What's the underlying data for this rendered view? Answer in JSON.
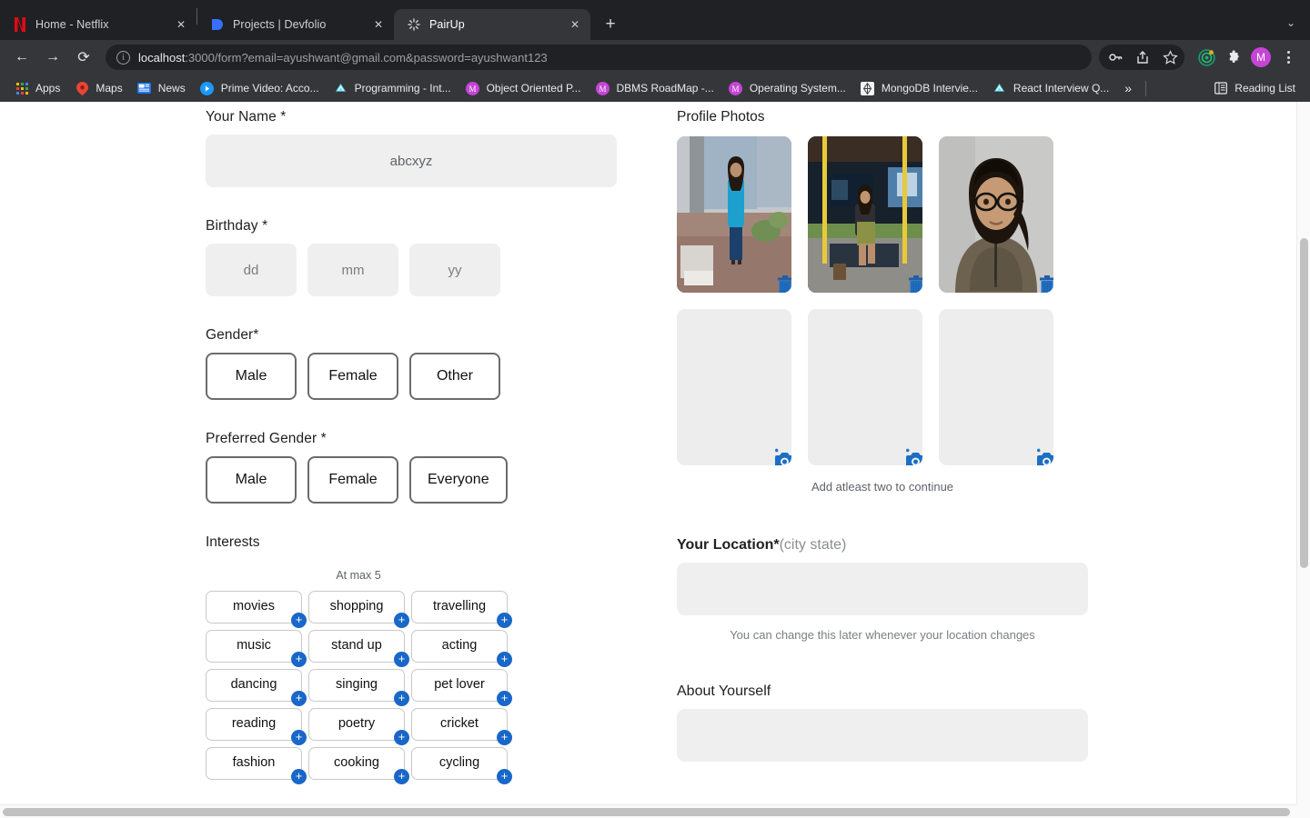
{
  "browser": {
    "tabs": [
      {
        "title": "Home - Netflix",
        "favicon": "netflix-icon",
        "active": false,
        "close_label": "✕"
      },
      {
        "title": "Projects | Devfolio",
        "favicon": "devfolio-icon",
        "active": false,
        "close_label": "✕"
      },
      {
        "title": "PairUp",
        "favicon": "loading-spinner-icon",
        "active": true,
        "close_label": "✕"
      }
    ],
    "new_tab_label": "+",
    "tabstrip_chevron": "⌄",
    "nav": {
      "back": "←",
      "forward": "→",
      "reload": "⟳"
    },
    "omnibox": {
      "info_icon_label": "i",
      "url_host": "localhost",
      "url_rest": ":3000/form?email=ayushwant@gmail.com&password=ayushwant123",
      "full_url": "localhost:3000/form?email=ayushwant@gmail.com&password=ayushwant123"
    },
    "toolbar_icons": [
      "password-key-icon",
      "share-icon",
      "bookmark-star-icon",
      "extension-target-icon",
      "extensions-puzzle-icon",
      "profile-avatar",
      "browser-menu-icon"
    ],
    "avatar_initial": "M",
    "bookmarks": [
      {
        "label": "Apps",
        "icon": "apps-grid-icon"
      },
      {
        "label": "Maps",
        "icon": "google-maps-pin-icon"
      },
      {
        "label": "News",
        "icon": "google-news-icon"
      },
      {
        "label": "Prime Video: Acco...",
        "icon": "prime-video-icon"
      },
      {
        "label": "Programming - Int...",
        "icon": "medium-bookmark-icon"
      },
      {
        "label": "Object Oriented P...",
        "icon": "medium-m-icon"
      },
      {
        "label": "DBMS RoadMap -...",
        "icon": "medium-m-icon"
      },
      {
        "label": "Operating System...",
        "icon": "medium-m-icon"
      },
      {
        "label": "MongoDB Intervie...",
        "icon": "mongodb-icon"
      },
      {
        "label": "React Interview Q...",
        "icon": "medium-bookmark-icon"
      }
    ],
    "bookmarks_overflow_label": "»",
    "reading_list": {
      "label": "Reading List",
      "icon": "reading-list-icon"
    }
  },
  "form": {
    "name": {
      "label": "Your Name *",
      "value": "abcxyz",
      "placeholder": "abcxyz"
    },
    "birthday": {
      "label": "Birthday *",
      "fields": [
        {
          "name": "day",
          "value": "",
          "placeholder": "dd"
        },
        {
          "name": "month",
          "value": "",
          "placeholder": "mm"
        },
        {
          "name": "year",
          "value": "",
          "placeholder": "yy"
        }
      ]
    },
    "gender": {
      "label": "Gender*",
      "options": [
        "Male",
        "Female",
        "Other"
      ],
      "selected": null
    },
    "preferred_gender": {
      "label": "Preferred Gender *",
      "options": [
        "Male",
        "Female",
        "Everyone"
      ],
      "selected": null
    },
    "interests": {
      "label": "Interests",
      "max_hint": "At max 5",
      "add_badge": "+",
      "items": [
        "movies",
        "shopping",
        "travelling",
        "music",
        "stand up",
        "acting",
        "dancing",
        "singing",
        "pet lover",
        "reading",
        "poetry",
        "cricket",
        "fashion",
        "cooking",
        "cycling"
      ]
    },
    "photos": {
      "label": "Profile Photos",
      "hint": "Add atleast two to continue",
      "slots": [
        {
          "state": "filled",
          "action_icon": "delete-trash-icon",
          "alt": "woman in blue kurta standing outdoors"
        },
        {
          "state": "filled",
          "action_icon": "delete-trash-icon",
          "alt": "woman sitting on yellow-chain swing"
        },
        {
          "state": "filled",
          "action_icon": "delete-trash-icon",
          "alt": "portrait of woman with glasses"
        },
        {
          "state": "empty",
          "action_icon": "add-photo-camera-icon",
          "alt": ""
        },
        {
          "state": "empty",
          "action_icon": "add-photo-camera-icon",
          "alt": ""
        },
        {
          "state": "empty",
          "action_icon": "add-photo-camera-icon",
          "alt": ""
        }
      ]
    },
    "location": {
      "label_main": "Your Location*",
      "label_note": "(city state)",
      "value": "",
      "placeholder": "",
      "hint": "You can change this later whenever your location changes"
    },
    "about": {
      "label": "About Yourself",
      "value": "",
      "placeholder": ""
    }
  },
  "colors": {
    "accent_blue": "#1967c8",
    "chrome_dark": "#35363a",
    "tabstrip_dark": "#202124",
    "input_grey": "#efefef",
    "pill_border": "#6b6b6b",
    "avatar_purple": "#c545d6"
  }
}
